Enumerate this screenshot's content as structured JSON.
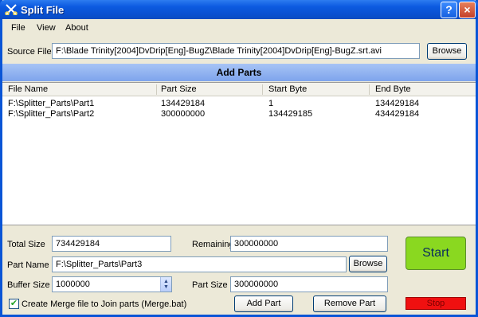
{
  "window": {
    "title": "Split File"
  },
  "menu": [
    "File",
    "View",
    "About"
  ],
  "source": {
    "label": "Source File",
    "value": "F:\\Blade Trinity[2004]DvDrip[Eng]-BugZ\\Blade Trinity[2004]DvDrip[Eng]-BugZ.srt.avi",
    "browse": "Browse"
  },
  "section_title": "Add Parts",
  "table": {
    "columns": [
      "File Name",
      "Part Size",
      "Start Byte",
      "End Byte"
    ],
    "rows": [
      [
        "F:\\Splitter_Parts\\Part1",
        "134429184",
        "1",
        "134429184"
      ],
      [
        "F:\\Splitter_Parts\\Part2",
        "300000000",
        "134429185",
        "434429184"
      ]
    ]
  },
  "form": {
    "total_size_label": "Total Size",
    "total_size": "734429184",
    "remaining_label": "Remaining",
    "remaining": "300000000",
    "part_name_label": "Part Name",
    "part_name": "F:\\Splitter_Parts\\Part3",
    "browse": "Browse",
    "buffer_size_label": "Buffer Size",
    "buffer_size": "1000000",
    "part_size_label": "Part Size",
    "part_size": "300000000",
    "merge_label": "Create Merge file to Join parts (Merge.bat)",
    "merge_checked": true,
    "add_part": "Add Part",
    "remove_part": "Remove Part"
  },
  "actions": {
    "start": "Start",
    "stop": "Stop"
  },
  "titlebar_buttons": {
    "help": "?",
    "close": "×"
  }
}
